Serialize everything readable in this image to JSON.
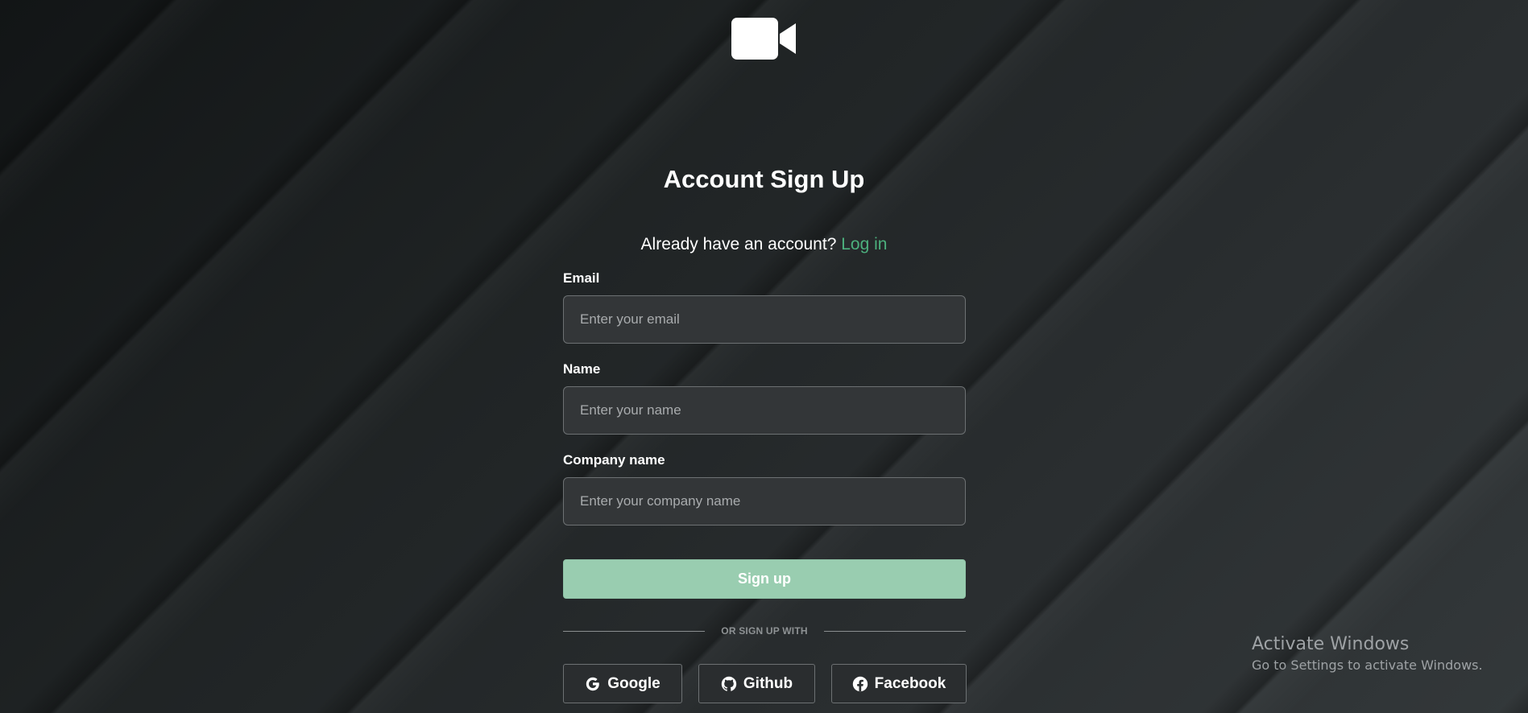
{
  "logo": {
    "icon": "video-camera-icon"
  },
  "page_title": "Account Sign Up",
  "login_prompt": {
    "text": "Already have an account?",
    "link": "Log in",
    "link_color": "#4cb07d"
  },
  "form": {
    "email": {
      "label": "Email",
      "placeholder": "Enter your email",
      "value": ""
    },
    "name": {
      "label": "Name",
      "placeholder": "Enter your name",
      "value": ""
    },
    "company": {
      "label": "Company name",
      "placeholder": "Enter your company name",
      "value": ""
    }
  },
  "signup_button": {
    "label": "Sign up",
    "color": "#99cdb0"
  },
  "divider_text": "OR SIGN UP WITH",
  "social": {
    "google": {
      "label": "Google",
      "icon": "google-icon"
    },
    "github": {
      "label": "Github",
      "icon": "github-icon"
    },
    "facebook": {
      "label": "Facebook",
      "icon": "facebook-icon"
    }
  },
  "watermark": {
    "title": "Activate Windows",
    "subtitle": "Go to Settings to activate Windows."
  }
}
